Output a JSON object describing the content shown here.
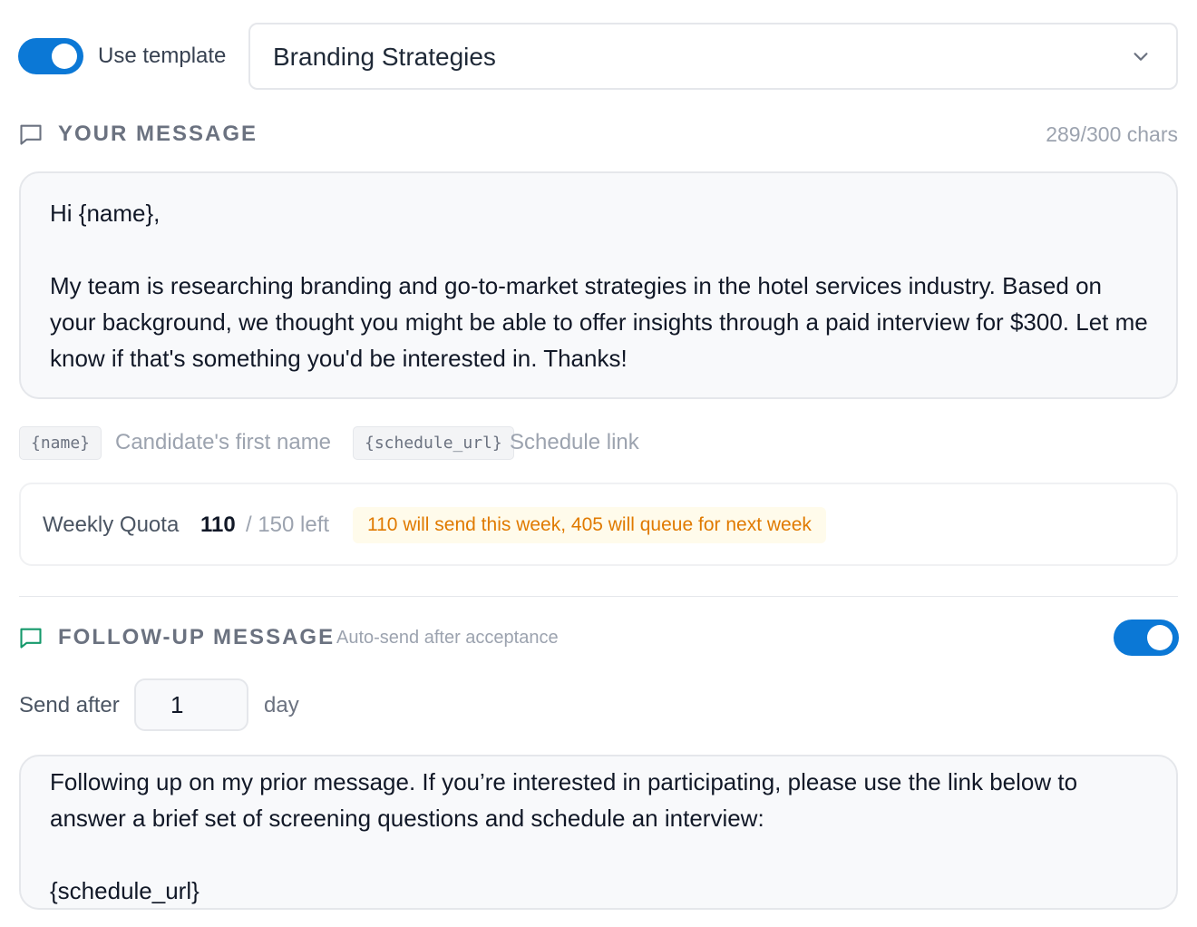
{
  "template": {
    "toggle_on": true,
    "label": "Use template",
    "selected": "Branding Strategies"
  },
  "message": {
    "title": "YOUR MESSAGE",
    "char_count": "289/300 chars",
    "body": "Hi {name},\n\nMy team is researching branding and go-to-market strategies in the hotel services industry. Based on your background, we thought you might be able to offer insights through a paid interview for $300. Let me know if that's something you'd be interested in. Thanks!"
  },
  "variables": [
    {
      "token": "{name}",
      "description": "Candidate's first name"
    },
    {
      "token": "{schedule_url}",
      "description": "Schedule link"
    }
  ],
  "quota": {
    "label": "Weekly Quota",
    "used": "110",
    "total": "/ 150 left",
    "notice": "110 will send this week, 405 will queue for next week"
  },
  "followup": {
    "title": "FOLLOW-UP MESSAGE",
    "subtitle": "Auto-send after acceptance",
    "toggle_on": true,
    "send_after_label": "Send after",
    "send_after_value": "1",
    "send_after_unit": "day",
    "body": "Following up on my prior message. If you’re interested in participating, please use the link below to answer a brief set of screening questions and schedule an interview:\n\n{schedule_url}"
  },
  "colors": {
    "accent": "#0b78d6",
    "followup_icon": "#15996b",
    "notice_text": "#e07a00",
    "notice_bg": "#fffbeb"
  },
  "icons": {
    "message": "message-square-icon",
    "followup": "message-square-icon",
    "select": "chevron-down-icon"
  }
}
